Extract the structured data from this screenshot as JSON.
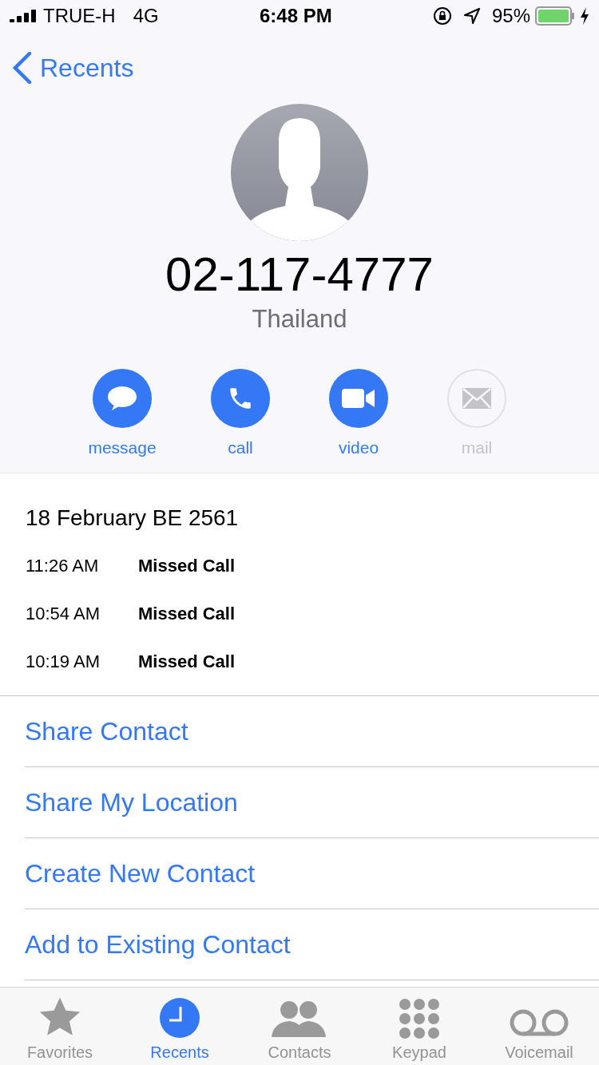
{
  "status_bar": {
    "carrier": "TRUE-H",
    "network": "4G",
    "time": "6:48 PM",
    "battery": "95%"
  },
  "nav": {
    "back": "Recents"
  },
  "contact": {
    "number": "02-117-4777",
    "location": "Thailand"
  },
  "actions": [
    {
      "kind": "message",
      "label": "message",
      "disabled": false
    },
    {
      "kind": "call",
      "label": "call",
      "disabled": false
    },
    {
      "kind": "video",
      "label": "video",
      "disabled": false
    },
    {
      "kind": "mail",
      "label": "mail",
      "disabled": true
    }
  ],
  "history": {
    "date": "18 February BE 2561",
    "calls": [
      {
        "time": "11:26 AM",
        "type": "Missed Call"
      },
      {
        "time": "10:54 AM",
        "type": "Missed Call"
      },
      {
        "time": "10:19 AM",
        "type": "Missed Call"
      }
    ]
  },
  "options": [
    "Share Contact",
    "Share My Location",
    "Create New Contact",
    "Add to Existing Contact"
  ],
  "tabs": [
    {
      "kind": "favorites",
      "label": "Favorites",
      "selected": false
    },
    {
      "kind": "recents",
      "label": "Recents",
      "selected": true
    },
    {
      "kind": "contacts",
      "label": "Contacts",
      "selected": false
    },
    {
      "kind": "keypad",
      "label": "Keypad",
      "selected": false
    },
    {
      "kind": "voicemail",
      "label": "Voicemail",
      "selected": false
    }
  ]
}
